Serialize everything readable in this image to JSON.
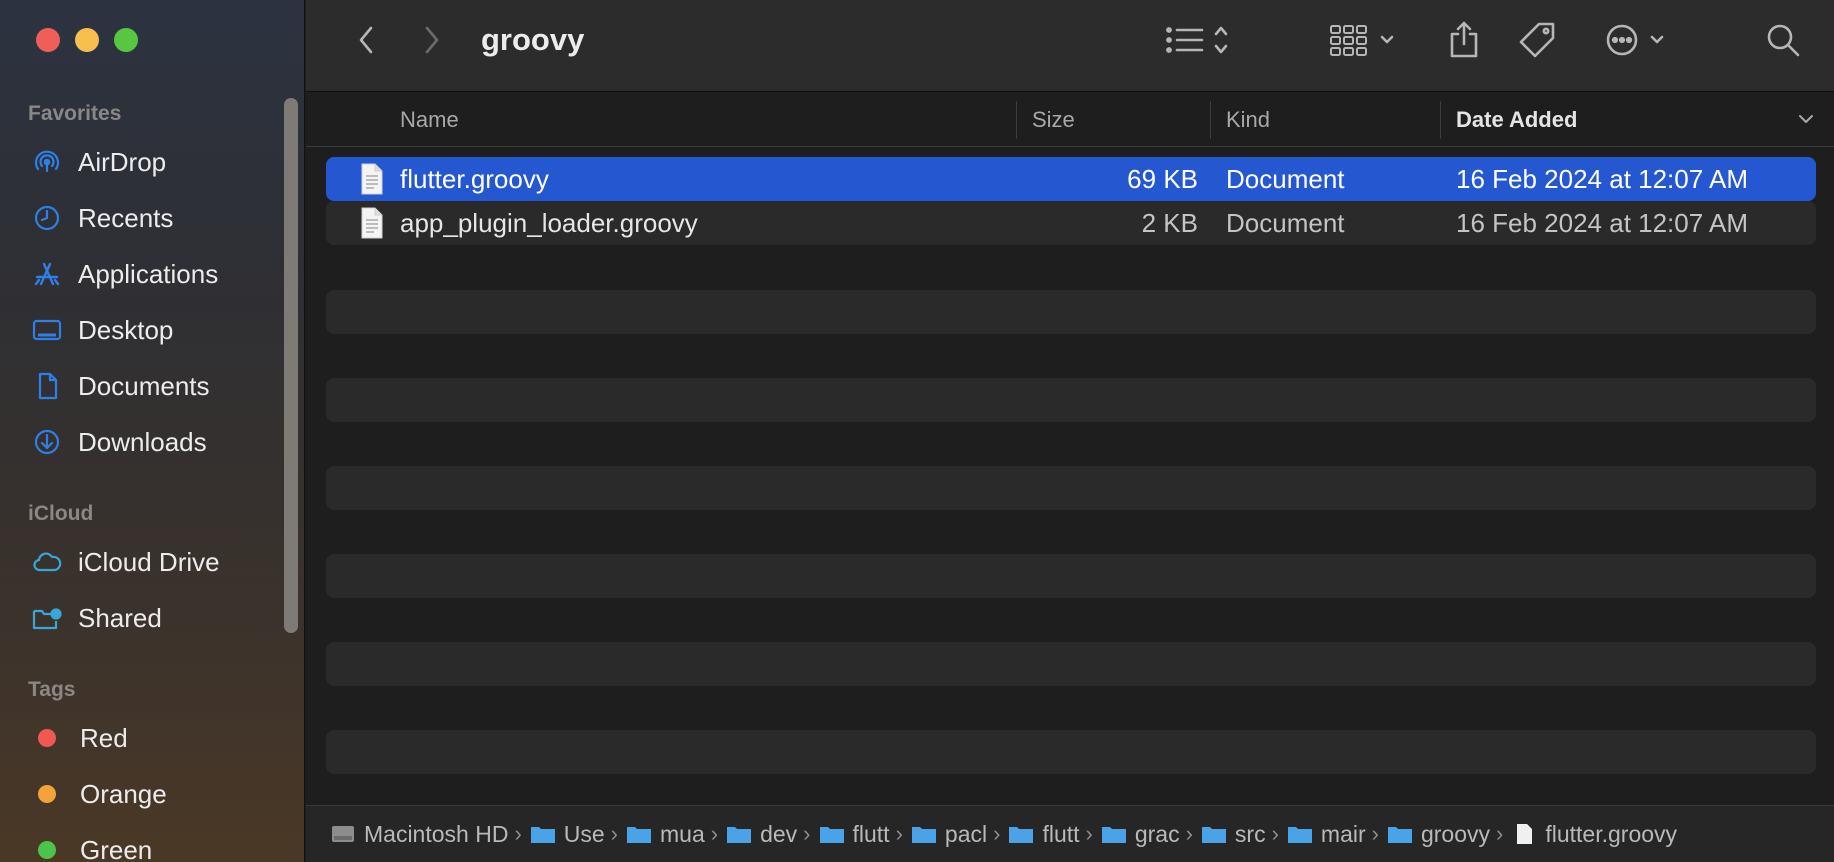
{
  "window": {
    "title": "groovy"
  },
  "sidebar": {
    "favorites_heading": "Favorites",
    "favorites": [
      {
        "label": "AirDrop",
        "icon": "airdrop-icon"
      },
      {
        "label": "Recents",
        "icon": "clock-icon"
      },
      {
        "label": "Applications",
        "icon": "applications-icon"
      },
      {
        "label": "Desktop",
        "icon": "desktop-icon"
      },
      {
        "label": "Documents",
        "icon": "document-icon"
      },
      {
        "label": "Downloads",
        "icon": "download-icon"
      }
    ],
    "icloud_heading": "iCloud",
    "icloud": [
      {
        "label": "iCloud Drive",
        "icon": "cloud-icon"
      },
      {
        "label": "Shared",
        "icon": "shared-folder-icon"
      }
    ],
    "tags_heading": "Tags",
    "tags": [
      {
        "label": "Red",
        "color": "#ee5a52"
      },
      {
        "label": "Orange",
        "color": "#f3a33a"
      },
      {
        "label": "Green",
        "color": "#4cc34a"
      }
    ]
  },
  "columns": {
    "name": "Name",
    "size": "Size",
    "kind": "Kind",
    "date": "Date Added"
  },
  "files": [
    {
      "name": "flutter.groovy",
      "size": "69 KB",
      "kind": "Document",
      "date": "16 Feb 2024 at 12:07 AM",
      "selected": true
    },
    {
      "name": "app_plugin_loader.groovy",
      "size": "2 KB",
      "kind": "Document",
      "date": "16 Feb 2024 at 12:07 AM",
      "selected": false
    }
  ],
  "pathbar": [
    "Macintosh HD",
    "Use",
    "mua",
    "dev",
    "flutt",
    "pacl",
    "flutt",
    "grac",
    "src",
    "mair",
    "groovy",
    "flutter.groovy"
  ],
  "colors": {
    "selection": "#2558d0",
    "accent": "#2f7fe8"
  }
}
